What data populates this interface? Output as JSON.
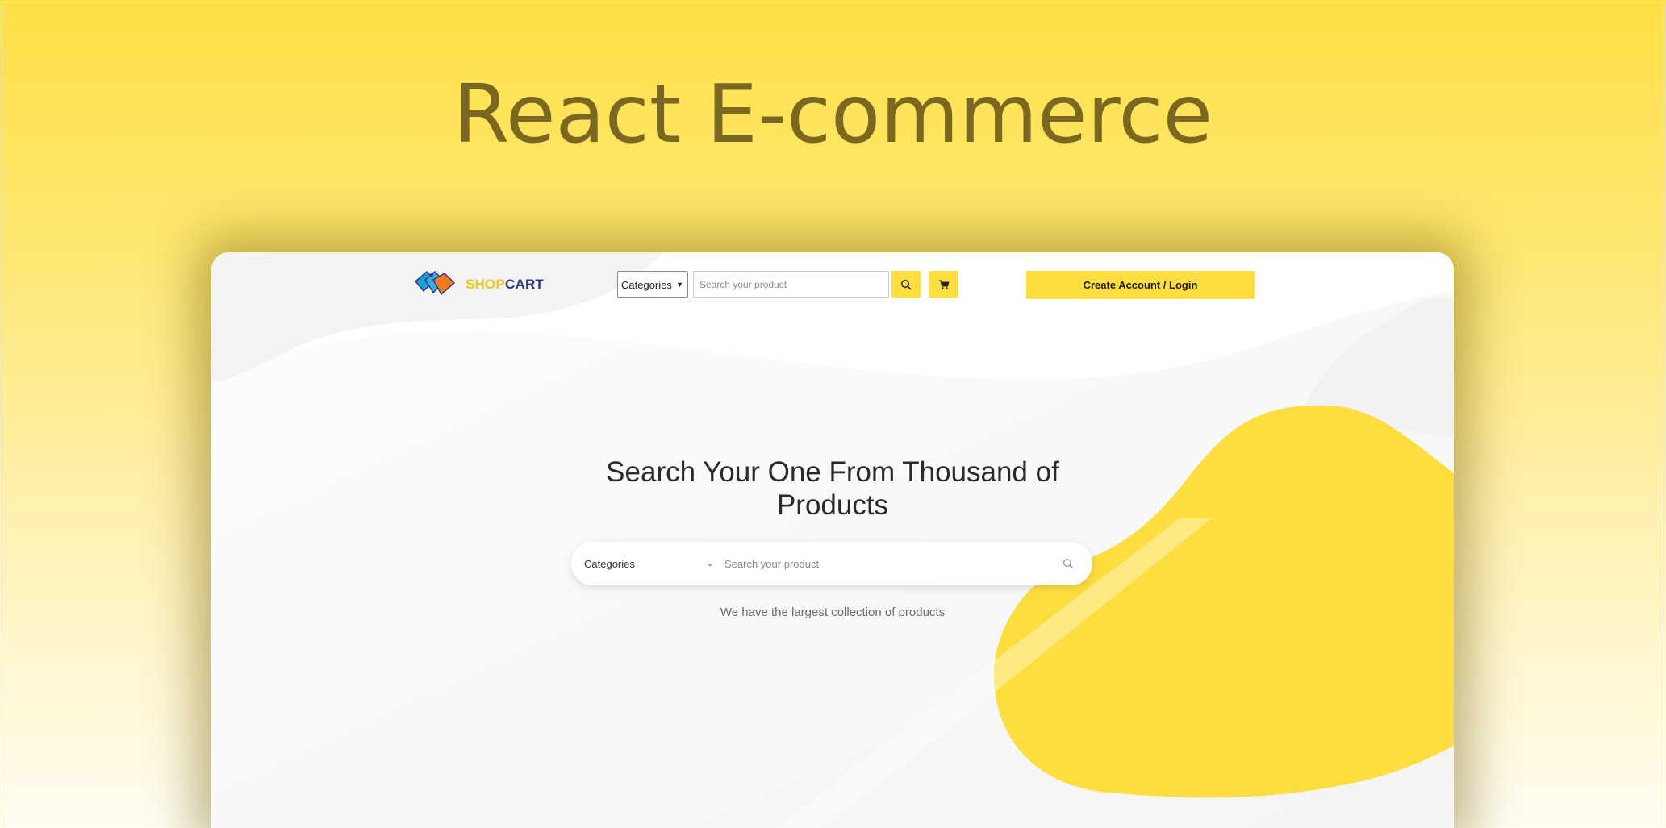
{
  "banner": {
    "title": "React E-commerce"
  },
  "colors": {
    "accent": "#fedd3f",
    "title": "#7a6820",
    "brand_shop": "#f7c31c",
    "brand_cart": "#2e3a8c"
  },
  "navbar": {
    "logo": {
      "shop": "SHOP",
      "cart": "CART",
      "icon": "shopping-tags-logo"
    },
    "category_select": {
      "value": "Categories",
      "icon": "chevron-down-icon"
    },
    "search": {
      "placeholder": "Search your product"
    },
    "search_button_icon": "search-icon",
    "cart_button_icon": "cart-icon",
    "login_button": "Create Account / Login"
  },
  "hero": {
    "heading": "Search Your One From Thousand of Products",
    "category_select": {
      "value": "Categories",
      "icon": "chevron-down-icon"
    },
    "search": {
      "placeholder": "Search your product",
      "icon": "search-icon"
    },
    "subtitle": "We have the largest collection of products"
  }
}
